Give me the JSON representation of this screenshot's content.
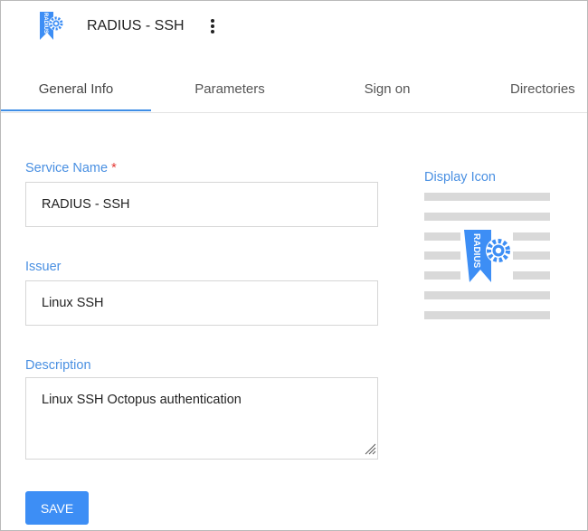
{
  "app": {
    "title": "RADIUS - SSH",
    "icon_text": "RADIUS",
    "icon": "radius-gear-badge-icon",
    "menu_icon": "kebab-menu-icon"
  },
  "tabs": [
    {
      "label": "General Info",
      "active": true
    },
    {
      "label": "Parameters",
      "active": false
    },
    {
      "label": "Sign on",
      "active": false
    },
    {
      "label": "Directories",
      "active": false
    }
  ],
  "form": {
    "service_name": {
      "label": "Service Name",
      "required_mark": "*",
      "value": "RADIUS - SSH"
    },
    "issuer": {
      "label": "Issuer",
      "value": "Linux SSH"
    },
    "description": {
      "label": "Description",
      "value": "Linux SSH Octopus authentication"
    },
    "save_label": "SAVE"
  },
  "display_icon": {
    "label": "Display Icon"
  },
  "colors": {
    "accent": "#4a90e2",
    "button": "#3d8ef5",
    "required": "#e53935"
  }
}
